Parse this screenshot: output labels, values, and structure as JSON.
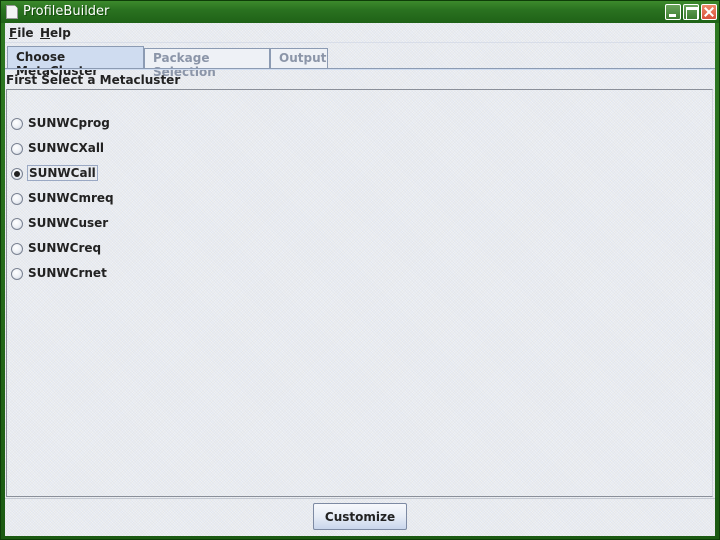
{
  "window": {
    "title": "ProfileBuilder",
    "icon": "document-icon",
    "controls": [
      "minimize",
      "maximize",
      "close"
    ]
  },
  "menubar": {
    "items": [
      {
        "label": "File",
        "mnemonic": "F",
        "rest": "ile"
      },
      {
        "label": "Help",
        "mnemonic": "H",
        "rest": "elp"
      }
    ]
  },
  "tabs": [
    {
      "label": "Choose MetaCluster",
      "selected": true,
      "enabled": true
    },
    {
      "label": "Package Selection",
      "selected": false,
      "enabled": false
    },
    {
      "label": "Output",
      "selected": false,
      "enabled": false
    }
  ],
  "panel": {
    "label": "First Select a Metacluster",
    "options": [
      {
        "label": "SUNWCprog",
        "checked": false
      },
      {
        "label": "SUNWCXall",
        "checked": false
      },
      {
        "label": "SUNWCall",
        "checked": true
      },
      {
        "label": "SUNWCmreq",
        "checked": false
      },
      {
        "label": "SUNWCuser",
        "checked": false
      },
      {
        "label": "SUNWCreq",
        "checked": false
      },
      {
        "label": "SUNWCrnet",
        "checked": false
      }
    ]
  },
  "footer": {
    "customize_label": "Customize"
  }
}
